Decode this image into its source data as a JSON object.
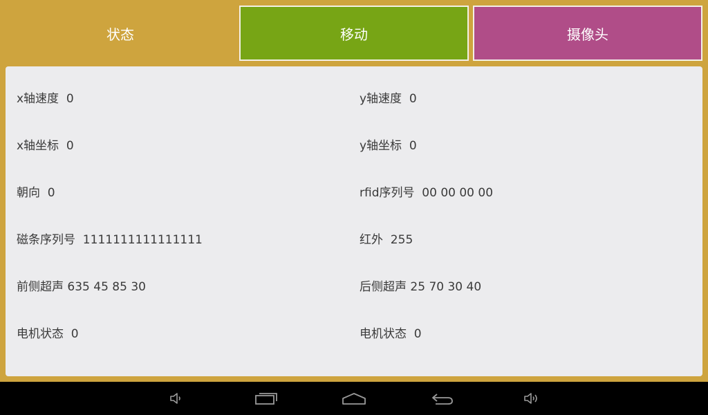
{
  "tabs": {
    "status": "状态",
    "move": "移动",
    "camera": "摄像头"
  },
  "fields": {
    "x_speed": "x轴速度  0",
    "y_speed": "y轴速度  0",
    "x_coord": "x轴坐标  0",
    "y_coord": "y轴坐标  0",
    "heading": "朝向  0",
    "rfid": "rfid序列号  00 00 00 00",
    "magnetic_strip": "磁条序列号  1111111111111111",
    "infrared": "红外  255",
    "front_ultrasonic": "前侧超声 635 45 85 30",
    "rear_ultrasonic": "后侧超声 25 70 30 40",
    "motor_status_left": "电机状态  0",
    "motor_status_right": "电机状态  0"
  },
  "navbar": {
    "icons": [
      "volume-down-icon",
      "recent-apps-icon",
      "home-icon",
      "back-icon",
      "volume-up-icon"
    ]
  },
  "colors": {
    "background": "#cea43e",
    "tab_move": "#77a515",
    "tab_camera": "#b04d88",
    "panel": "#ececee",
    "navbar": "#000000"
  }
}
